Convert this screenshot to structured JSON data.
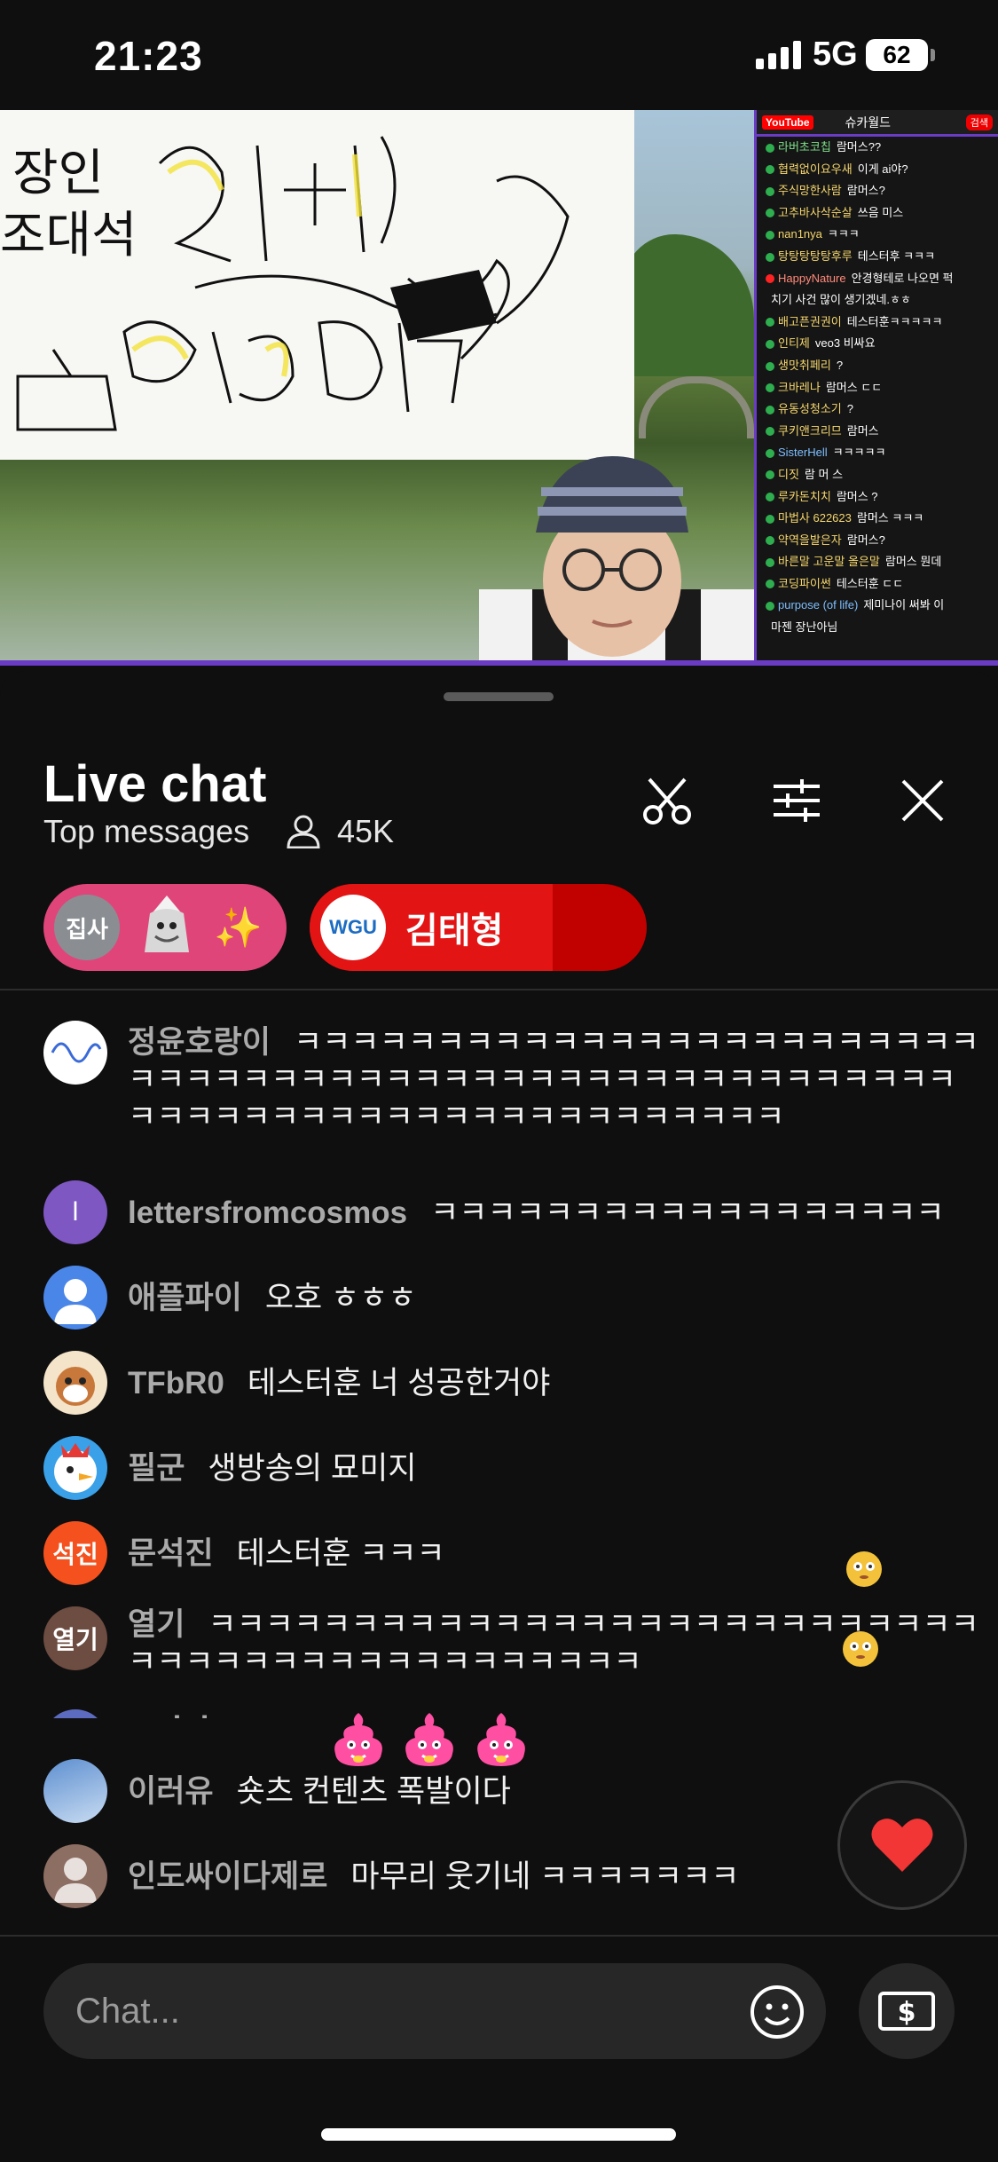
{
  "status_bar": {
    "time": "21:23",
    "network": "5G",
    "battery": "62"
  },
  "video": {
    "whiteboard_lines": [
      "장인",
      "조대석"
    ],
    "side_chat": {
      "platform": "YouTube",
      "channel": "슈카월드",
      "badge": "검색",
      "messages": [
        {
          "name": "라버초코칩",
          "text": "람머스??",
          "color": "g"
        },
        {
          "name": "협력없이요우새",
          "text": "이게 ai야?",
          "color": "y"
        },
        {
          "name": "주식망한사람",
          "text": "람머스?",
          "color": "y"
        },
        {
          "name": "고추바사삭순살",
          "text": "쓰음 미스",
          "color": "y"
        },
        {
          "name": "nan1nya",
          "text": "ㅋㅋㅋ",
          "color": "y"
        },
        {
          "name": "탕탕탕탕탕후루",
          "text": "테스터후 ㅋㅋㅋ",
          "color": "y"
        },
        {
          "name": "HappyNature",
          "text": "안경형테로 나오면 퍽",
          "color": "r"
        },
        {
          "name": "",
          "text": "치기 사건 많이 생기겠네.ㅎㅎ",
          "color": "y"
        },
        {
          "name": "배고픈권권이",
          "text": "테스터훈ㅋㅋㅋㅋㅋ",
          "color": "y"
        },
        {
          "name": "인티제",
          "text": "veo3 비싸요",
          "color": "y"
        },
        {
          "name": "생맛취페리",
          "text": "?",
          "color": "y"
        },
        {
          "name": "크바레나",
          "text": "람머스 ㄷㄷ",
          "color": "y"
        },
        {
          "name": "유동성청소기",
          "text": "?",
          "color": "y"
        },
        {
          "name": "쿠키앤크리므",
          "text": "람머스",
          "color": "y"
        },
        {
          "name": "SisterHell",
          "text": "ㅋㅋㅋㅋㅋ",
          "color": "b"
        },
        {
          "name": "디짓",
          "text": "람 머 스",
          "color": "y"
        },
        {
          "name": "루카돈치치",
          "text": "람머스 ?",
          "color": "y"
        },
        {
          "name": "마법사 622623",
          "text": "람머스 ㅋㅋㅋ",
          "color": "y"
        },
        {
          "name": "약역을발은자",
          "text": "람머스?",
          "color": "y"
        },
        {
          "name": "바른말 고운말 올은말",
          "text": "람머스 뭔데",
          "color": "y"
        },
        {
          "name": "코딩파이썬",
          "text": "테스터훈 ㄷㄷ",
          "color": "y"
        },
        {
          "name": "purpose (of life)",
          "text": "제미나이 써봐 이",
          "color": "b"
        },
        {
          "name": "",
          "text": "마젠 장난아님",
          "color": "y"
        }
      ]
    }
  },
  "chat_panel": {
    "title": "Live chat",
    "mode": "Top messages",
    "viewer_count": "45K",
    "pinned": [
      {
        "avatar_text": "집사",
        "label": "",
        "emoji": "✨",
        "color": "#e0457a"
      },
      {
        "avatar_text": "WGU",
        "label": "김태형",
        "progress": 0.72,
        "color": "#c10000"
      }
    ],
    "messages": [
      {
        "name": "정윤호랑이",
        "text": "ㅋㅋㅋㅋㅋㅋㅋㅋㅋㅋㅋㅋㅋㅋㅋㅋㅋㅋㅋㅋㅋㅋㅋㅋㅋㅋㅋㅋㅋㅋㅋㅋㅋㅋㅋㅋㅋㅋㅋㅋㅋㅋㅋㅋㅋㅋㅋㅋㅋㅋㅋㅋㅋㅋㅋㅋㅋㅋㅋㅋㅋㅋㅋㅋㅋㅋㅋㅋㅋㅋㅋㅋㅋㅋㅋㅋ",
        "avatar": "wave",
        "avatar_color": "#ffffff"
      },
      {
        "name": "lettersfromcosmos",
        "text": "ㅋㅋㅋㅋㅋㅋㅋㅋㅋㅋㅋㅋㅋㅋㅋㅋㅋㅋ",
        "avatar": "l",
        "avatar_color": "#7e57c2"
      },
      {
        "name": "애플파이",
        "text": "오호 ㅎㅎㅎ",
        "avatar": "person",
        "avatar_color": "#4a86e8"
      },
      {
        "name": "TFbR0",
        "text": "테스터훈 너 성공한거야",
        "avatar": "cartoon",
        "avatar_color": "#e8b27a"
      },
      {
        "name": "필군",
        "text": "생방송의 묘미지",
        "avatar": "bird",
        "avatar_color": "#3aa0e8"
      },
      {
        "name": "문석진",
        "text": "테스터훈 ㅋㅋㅋ",
        "avatar": "석진",
        "avatar_color": "#f4511e"
      },
      {
        "name": "열기",
        "text": "ㅋㅋㅋㅋㅋㅋㅋㅋㅋㅋㅋㅋㅋㅋㅋㅋㅋㅋㅋㅋㅋㅋㅋㅋㅋㅋㅋㅋㅋㅋㅋㅋㅋㅋㅋㅋㅋㅋㅋㅋㅋㅋㅋㅋㅋ",
        "avatar": "열기",
        "avatar_color": "#6d4c41"
      },
      {
        "name": "majok_run",
        "text": "",
        "avatar": "m",
        "avatar_color": "#5c6bc0"
      },
      {
        "name": "이러유",
        "text": "숏츠 컨텐츠 폭발이다",
        "avatar": "sky",
        "avatar_color": "#7aa6d8"
      },
      {
        "name": "인도싸이다제로",
        "text": "마무리 웃기네 ㅋㅋㅋㅋㅋㅋㅋ",
        "avatar": "person-gray",
        "avatar_color": "#8d6e63"
      }
    ],
    "input_placeholder": "Chat...",
    "icons": {
      "clip": "scissors-icon",
      "settings": "sliders-icon",
      "close": "close-icon",
      "heart": "heart-icon",
      "emoji": "smiley-icon",
      "super_chat": "dollar-icon"
    },
    "accent": "#ff0000"
  }
}
